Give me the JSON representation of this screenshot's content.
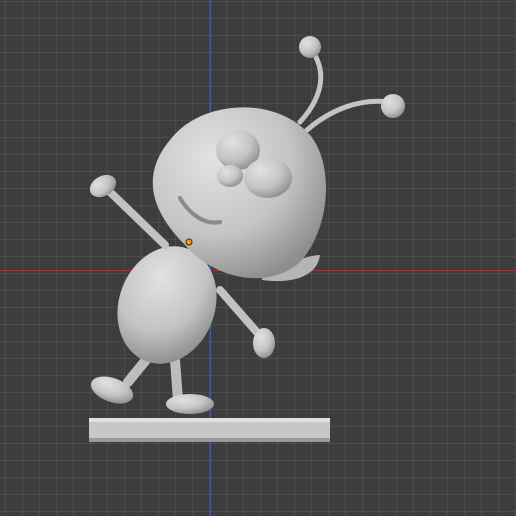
{
  "viewport": {
    "background": "#3d3d3d",
    "grid_line_color": "#4a4a4a",
    "x_axis_color": "#9c3a3a",
    "y_axis_color": "#3b5fa8"
  },
  "model": {
    "icon": "cartoon-ant-figure-icon",
    "clay_color": "#c9c9c9",
    "shadow_color": "#8f8f8f",
    "origin_marker_color": "#e8a21a"
  }
}
